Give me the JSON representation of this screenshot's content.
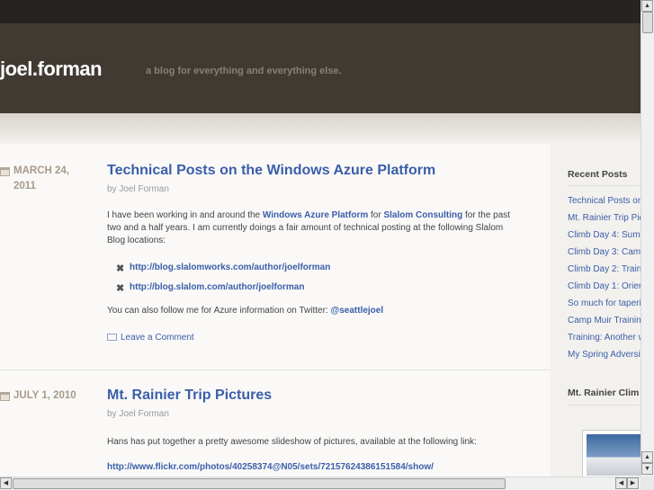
{
  "header": {
    "site_title": "joel.forman",
    "tagline": "a blog for everything and everything else."
  },
  "posts": [
    {
      "date": "MARCH 24, 2011",
      "title": "Technical Posts on the Windows Azure Platform",
      "byline": "by Joel Forman",
      "intro_before": "I have been working in and around the ",
      "intro_link1": "Windows Azure Platform",
      "intro_mid": " for ",
      "intro_link2": "Slalom Consulting",
      "intro_after": " for the past two and a half years.  I am currently doings a fair amount of technical posting at the following Slalom Blog locations:",
      "links": [
        "http://blog.slalomworks.com/author/joelforman",
        "http://blog.slalom.com/author/joelforman"
      ],
      "follow_text": "You can also follow me for Azure information on Twitter: ",
      "follow_handle": "@seattlejoel",
      "comment_label": "Leave a Comment"
    },
    {
      "date": "JULY 1, 2010",
      "title": "Mt. Rainier Trip Pictures",
      "byline": "by Joel Forman",
      "body": "Hans has put together a pretty awesome slideshow of pictures, available at the following link:",
      "link": "http://www.flickr.com/photos/40258374@N05/sets/72157624386151584/show/"
    }
  ],
  "sidebar": {
    "recent_heading": "Recent Posts",
    "recent_posts": [
      "Technical Posts on",
      "Mt. Rainier Trip Pic",
      "Climb Day 4: Sumr",
      "Climb Day 3: Camp",
      "Climb Day 2: Train",
      "Climb Day 1: Orier",
      "So much for taperi",
      "Camp Muir Training",
      "Training: Another w",
      "My Spring Adversi"
    ],
    "photos_heading": "Mt. Rainier Clim"
  },
  "colors": {
    "header": "#403a33",
    "topbar": "#262321",
    "link": "#3b5ea8",
    "date": "#a89a88"
  }
}
